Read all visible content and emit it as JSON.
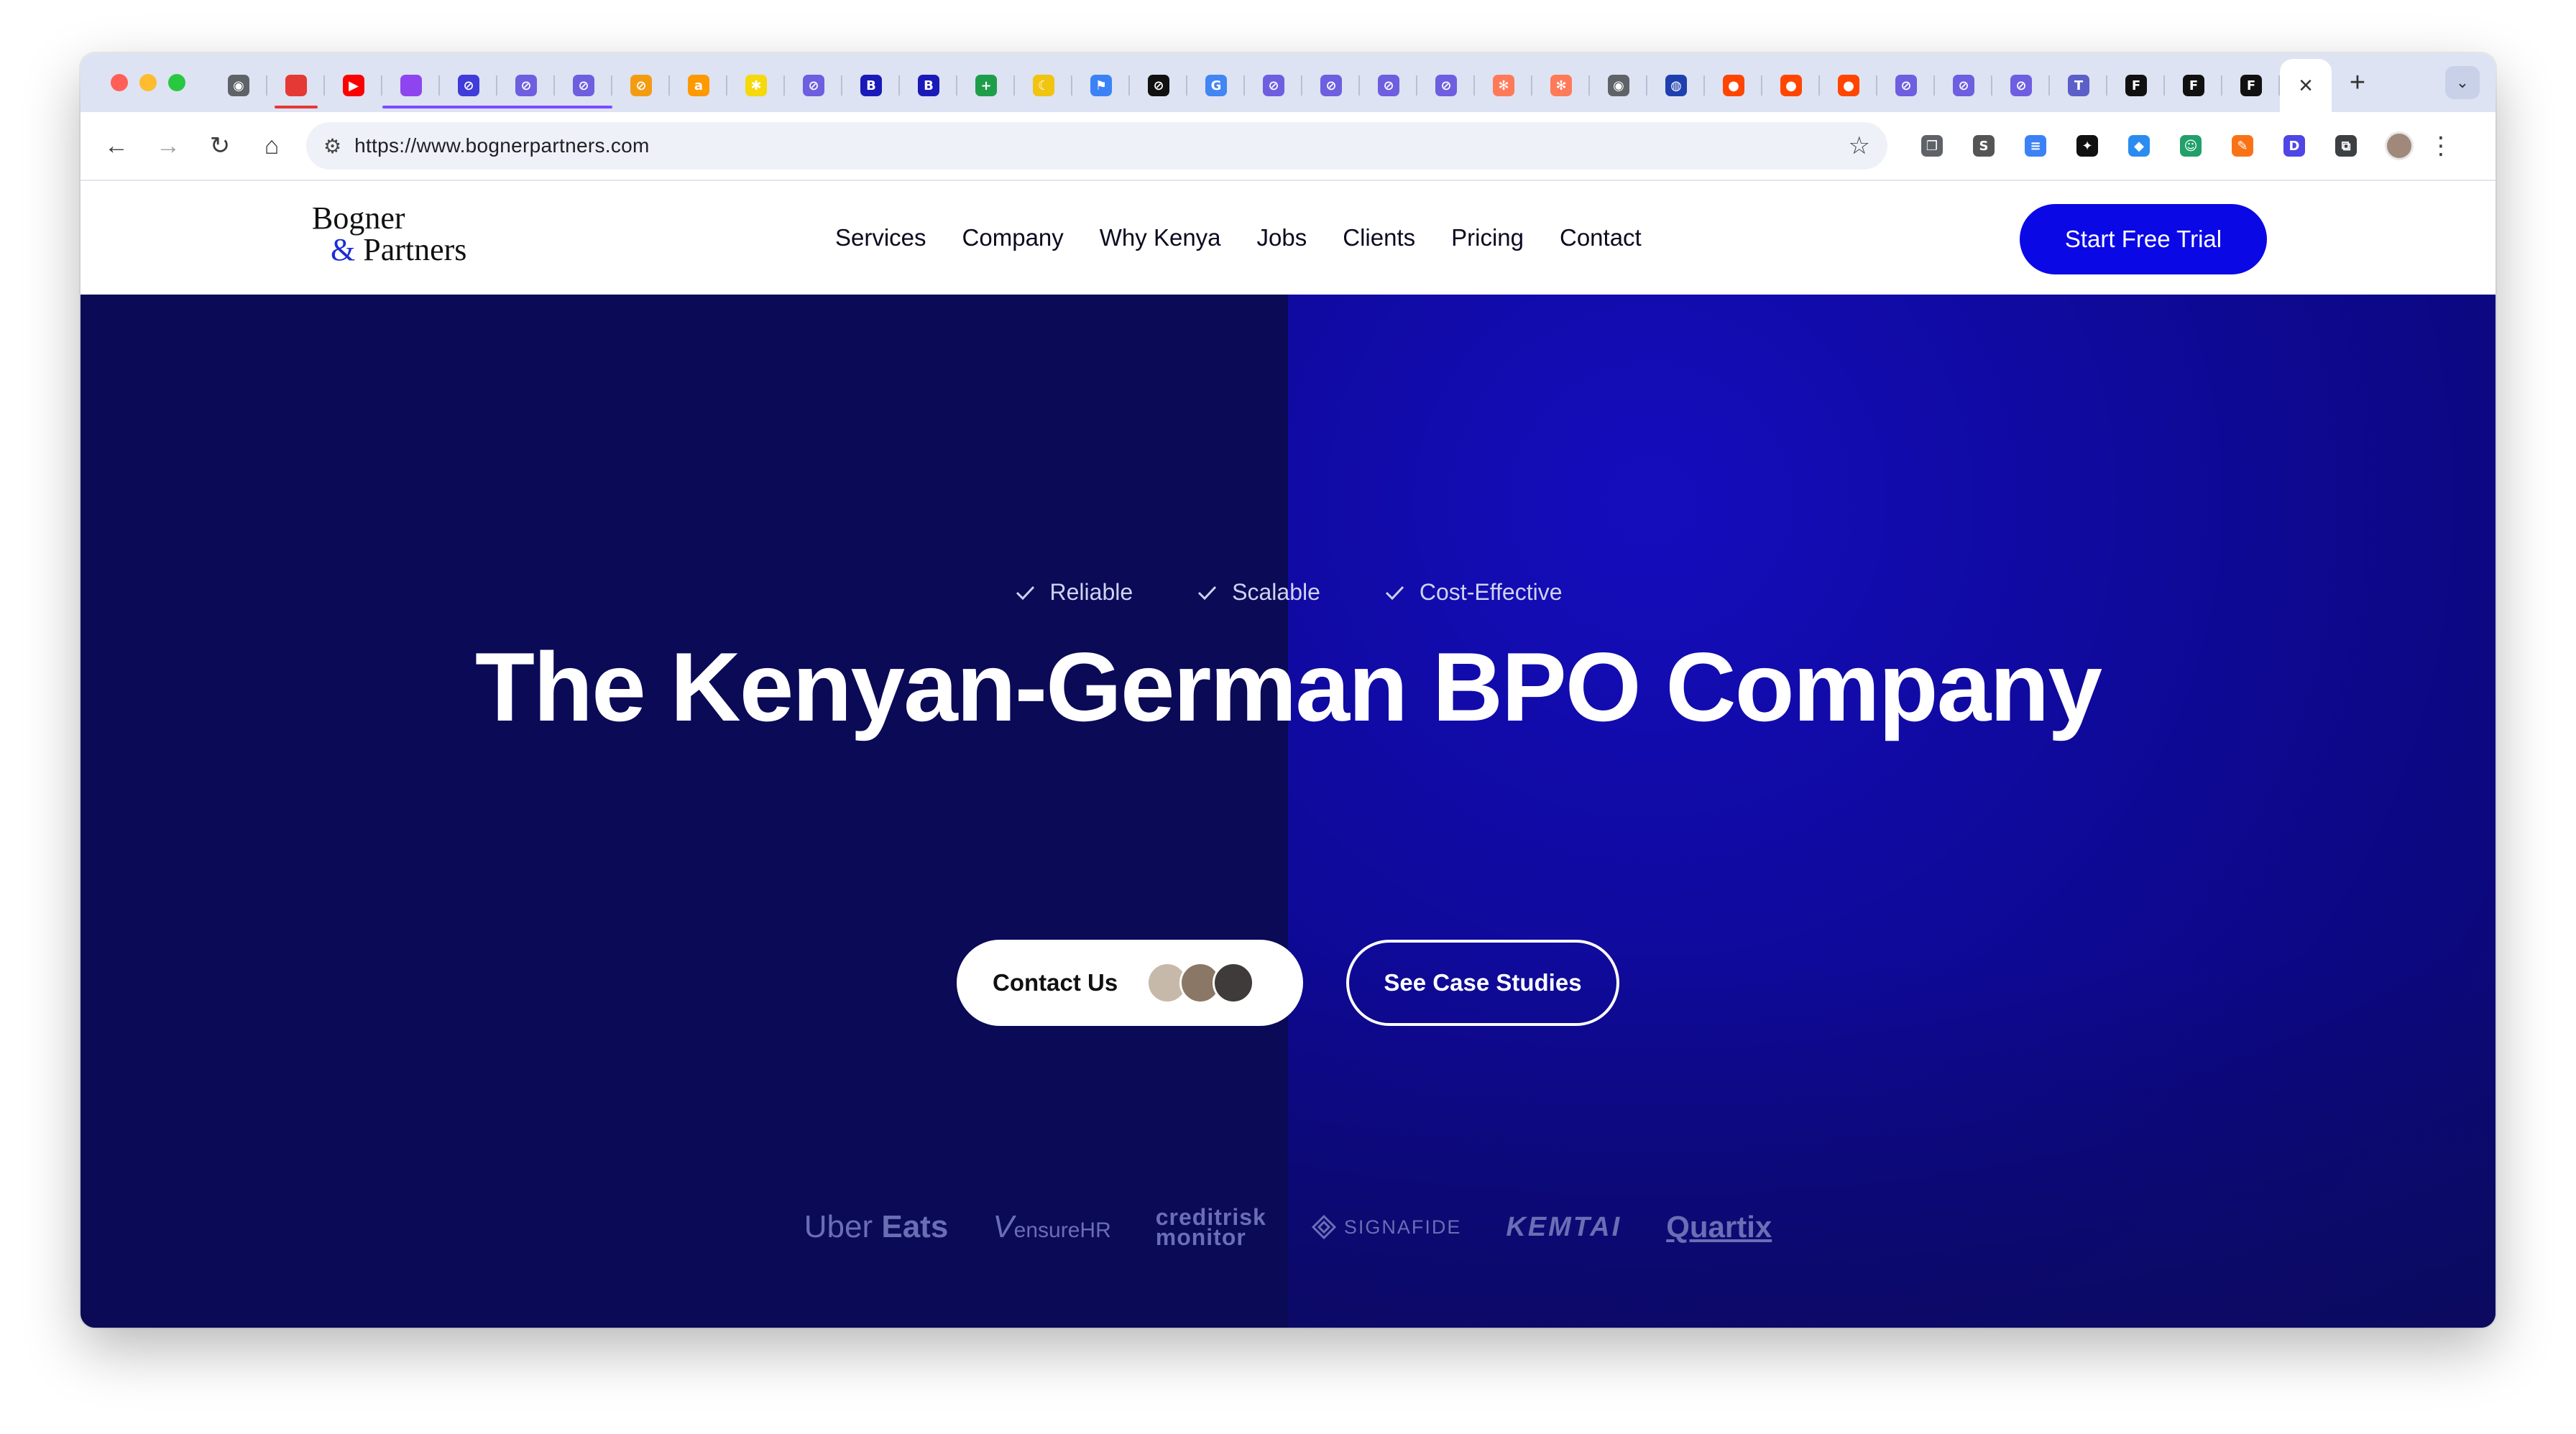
{
  "browser": {
    "tabs": [
      {
        "icon": "chrome-icon",
        "color": "#5f6368",
        "glyph": "◉"
      },
      {
        "icon": "red-app-icon",
        "color": "#e53935",
        "glyph": "",
        "group": "red"
      },
      {
        "icon": "youtube-icon",
        "color": "#ff0000",
        "glyph": "▶"
      },
      {
        "icon": "purple-app-icon",
        "color": "#8e44ef",
        "glyph": "",
        "group": "purple"
      },
      {
        "icon": "bolt-icon",
        "color": "#3f3cd9",
        "glyph": "⊘"
      },
      {
        "icon": "bolt-icon",
        "color": "#6e5ee0",
        "glyph": "⊘"
      },
      {
        "icon": "bolt-icon",
        "color": "#6e5ee0",
        "glyph": "⊘"
      },
      {
        "icon": "bolt-orange-icon",
        "color": "#f39c12",
        "glyph": "⊘"
      },
      {
        "icon": "amazon-icon",
        "color": "#ff9900",
        "glyph": "a"
      },
      {
        "icon": "asterisk-icon",
        "color": "#f5d90a",
        "glyph": "✱"
      },
      {
        "icon": "bolt-icon",
        "color": "#6e5ee0",
        "glyph": "⊘"
      },
      {
        "icon": "bp-icon",
        "color": "#1a1ab8",
        "glyph": "B"
      },
      {
        "icon": "bp-icon",
        "color": "#1a1ab8",
        "glyph": "B"
      },
      {
        "icon": "sheets-icon",
        "color": "#1e9e4a",
        "glyph": "+"
      },
      {
        "icon": "moon-icon",
        "color": "#f1c40f",
        "glyph": "☾"
      },
      {
        "icon": "flag-icon",
        "color": "#3b82f6",
        "glyph": "⚑"
      },
      {
        "icon": "compass-icon",
        "color": "#111111",
        "glyph": "⊘"
      },
      {
        "icon": "google-icon",
        "color": "#4285f4",
        "glyph": "G"
      },
      {
        "icon": "bolt-icon",
        "color": "#6e5ee0",
        "glyph": "⊘"
      },
      {
        "icon": "bolt-icon",
        "color": "#6e5ee0",
        "glyph": "⊘"
      },
      {
        "icon": "bolt-icon",
        "color": "#6e5ee0",
        "glyph": "⊘"
      },
      {
        "icon": "bolt-icon",
        "color": "#6e5ee0",
        "glyph": "⊘"
      },
      {
        "icon": "hubspot-icon",
        "color": "#ff7a59",
        "glyph": "✻"
      },
      {
        "icon": "hubspot-icon",
        "color": "#ff7a59",
        "glyph": "✻"
      },
      {
        "icon": "chrome-icon",
        "color": "#5f6368",
        "glyph": "◉"
      },
      {
        "icon": "globe-icon",
        "color": "#1e40af",
        "glyph": "◍"
      },
      {
        "icon": "reddit-icon",
        "color": "#ff4500",
        "glyph": "●"
      },
      {
        "icon": "reddit-icon",
        "color": "#ff4500",
        "glyph": "●"
      },
      {
        "icon": "reddit-icon",
        "color": "#ff4500",
        "glyph": "●"
      },
      {
        "icon": "bolt-icon",
        "color": "#6e5ee0",
        "glyph": "⊘"
      },
      {
        "icon": "bolt-icon",
        "color": "#6e5ee0",
        "glyph": "⊘"
      },
      {
        "icon": "bolt-icon",
        "color": "#6e5ee0",
        "glyph": "⊘"
      },
      {
        "icon": "teams-icon",
        "color": "#5b5fc7",
        "glyph": "T"
      },
      {
        "icon": "framer-icon",
        "color": "#111111",
        "glyph": "F"
      },
      {
        "icon": "framer-icon",
        "color": "#111111",
        "glyph": "F"
      },
      {
        "icon": "framer-icon",
        "color": "#111111",
        "glyph": "F"
      }
    ],
    "active_close_glyph": "×",
    "new_tab_glyph": "+",
    "tab_list_glyph": "⌄",
    "nav": {
      "back": "←",
      "forward": "→",
      "reload": "↻",
      "home": "⌂"
    },
    "site_info_glyph": "⚙",
    "url": "https://www.bognerpartners.com",
    "bookmark_glyph": "☆",
    "extensions": [
      {
        "icon": "copy-extension-icon",
        "color": "#5f6368",
        "glyph": "❐"
      },
      {
        "icon": "s-extension-icon",
        "color": "#555555",
        "glyph": "S"
      },
      {
        "icon": "bars-extension-icon",
        "color": "#3b82f6",
        "glyph": "≡"
      },
      {
        "icon": "bird-extension-icon",
        "color": "#111111",
        "glyph": "✦"
      },
      {
        "icon": "diamond-extension-icon",
        "color": "#2b8cf0",
        "glyph": "◆"
      },
      {
        "icon": "robot-extension-icon",
        "color": "#22a06b",
        "glyph": "☺"
      },
      {
        "icon": "pen-extension-icon",
        "color": "#f97316",
        "glyph": "✎"
      },
      {
        "icon": "d-extension-icon",
        "color": "#4f46e5",
        "glyph": "D"
      },
      {
        "icon": "puzzle-extension-icon",
        "color": "#3c4043",
        "glyph": "⧉"
      }
    ],
    "menu_glyph": "⋮"
  },
  "site": {
    "logo": {
      "line1": "Bogner",
      "amp": "&",
      "line2": " Partners"
    },
    "nav": [
      "Services",
      "Company",
      "Why Kenya",
      "Jobs",
      "Clients",
      "Pricing",
      "Contact"
    ],
    "cta": "Start Free Trial"
  },
  "hero": {
    "badges": [
      "Reliable",
      "Scalable",
      "Cost-Effective"
    ],
    "title": "The Kenyan-German BPO Company",
    "contact_label": "Contact Us",
    "cases_label": "See Case Studies",
    "client_logos": {
      "uber_a": "Uber",
      "uber_b": "Eats",
      "vensure_a": "V",
      "vensure_b": "ensureHR",
      "credit_a": "creditrisk",
      "credit_b": "monitor",
      "signafide": "SIGNAFIDE",
      "kemtai": "KEMTAI",
      "quartix": "Quartix"
    }
  },
  "colors": {
    "hero_dark": "#0b0a57",
    "hero_blue": "#150dbd",
    "cta_blue": "#0b08e6"
  }
}
